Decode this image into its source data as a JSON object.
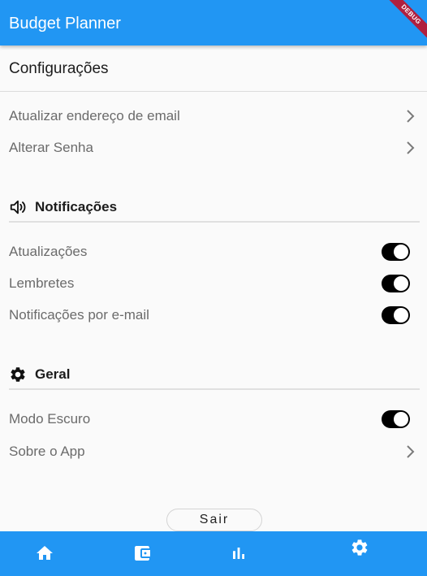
{
  "app": {
    "title": "Budget Planner",
    "debug_label": "DEBUG"
  },
  "colors": {
    "primary": "#2196f3",
    "background": "#fafafa",
    "toggle_active": "#000000",
    "debug_banner": "#b0203f"
  },
  "page": {
    "heading": "Configurações"
  },
  "account": {
    "items": [
      {
        "label": "Atualizar endereço de email",
        "icon": "chevron-right-icon"
      },
      {
        "label": "Alterar Senha",
        "icon": "chevron-right-icon"
      }
    ]
  },
  "notifications": {
    "title": "Notificações",
    "icon": "volume-icon",
    "items": [
      {
        "label": "Atualizações",
        "on": true
      },
      {
        "label": "Lembretes",
        "on": true
      },
      {
        "label": "Notificações por e-mail",
        "on": true
      }
    ]
  },
  "general": {
    "title": "Geral",
    "icon": "gear-icon",
    "dark_mode": {
      "label": "Modo Escuro",
      "on": true
    },
    "about": {
      "label": "Sobre o App",
      "icon": "chevron-right-icon"
    }
  },
  "logout": {
    "label": "Sair"
  },
  "bottom_nav": {
    "items": [
      {
        "icon": "home-icon",
        "selected": false
      },
      {
        "icon": "wallet-icon",
        "selected": false
      },
      {
        "icon": "bar-chart-icon",
        "selected": false
      },
      {
        "icon": "settings-icon",
        "selected": true
      }
    ]
  }
}
